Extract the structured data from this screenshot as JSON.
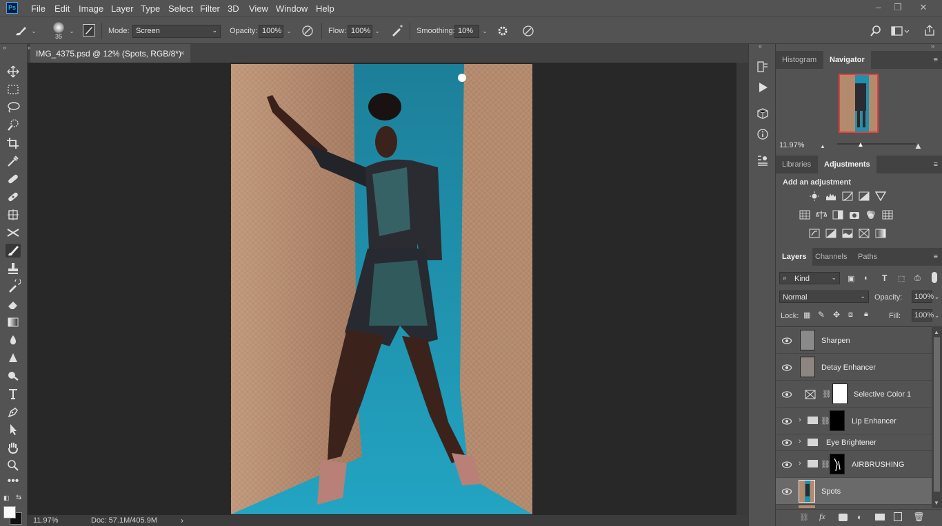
{
  "app": {
    "logo": "Ps",
    "accent": "#31a8ff"
  },
  "menu": [
    "File",
    "Edit",
    "Image",
    "Layer",
    "Type",
    "Select",
    "Filter",
    "3D",
    "View",
    "Window",
    "Help"
  ],
  "options": {
    "brush_size": "35",
    "mode_label": "Mode:",
    "mode_value": "Screen",
    "opacity_label": "Opacity:",
    "opacity_value": "100%",
    "flow_label": "Flow:",
    "flow_value": "100%",
    "smoothing_label": "Smoothing:",
    "smoothing_value": "10%"
  },
  "document": {
    "tab_title": "IMG_4375.psd @ 12% (Spots, RGB/8*)",
    "tab_close": "×",
    "zoom": "11.97%",
    "doc_size": "Doc: 57.1M/405.9M",
    "status_arrow": "›"
  },
  "panels": {
    "top_tabs": [
      "Histogram",
      "Navigator"
    ],
    "navigator_zoom": "11.97%",
    "mid_tabs": [
      "Libraries",
      "Adjustments"
    ],
    "add_adjustment": "Add an adjustment",
    "layer_tabs": [
      "Layers",
      "Channels",
      "Paths"
    ],
    "filter_kind": "Kind",
    "blend_mode": "Normal",
    "opacity_label": "Opacity:",
    "opacity_value": "100%",
    "lock_label": "Lock:",
    "fill_label": "Fill:",
    "fill_value": "100%",
    "menu_glyph": "≡"
  },
  "layers": [
    {
      "name": "Sharpen",
      "type": "pixel",
      "selected": false
    },
    {
      "name": "Detay Enhancer",
      "type": "pixel",
      "selected": false
    },
    {
      "name": "Selective Color 1",
      "type": "adjustment",
      "selected": false
    },
    {
      "name": "Lip Enhancer",
      "type": "group",
      "selected": false
    },
    {
      "name": "Eye Brightener",
      "type": "group",
      "selected": false
    },
    {
      "name": "AIRBRUSHING",
      "type": "group",
      "selected": false
    },
    {
      "name": "Spots",
      "type": "pixel",
      "selected": true
    }
  ],
  "icons": {
    "tools": [
      "move-icon",
      "marquee-icon",
      "lasso-icon",
      "quick-select-icon",
      "crop-icon",
      "eyedropper-icon",
      "healing-icon",
      "patch-icon",
      "content-aware-icon",
      "crossover-icon",
      "brush-icon",
      "stamp-icon",
      "history-brush-icon",
      "eraser-icon",
      "gradient-icon",
      "blur-icon",
      "sharpen-icon",
      "dodge-icon",
      "type-icon",
      "pen-icon",
      "path-select-icon",
      "hand-icon",
      "zoom-icon",
      "more-icon"
    ]
  },
  "colors": {
    "chrome": "#535353",
    "canvas_bg": "#282828",
    "photo_bg": "#1e9bb8"
  }
}
